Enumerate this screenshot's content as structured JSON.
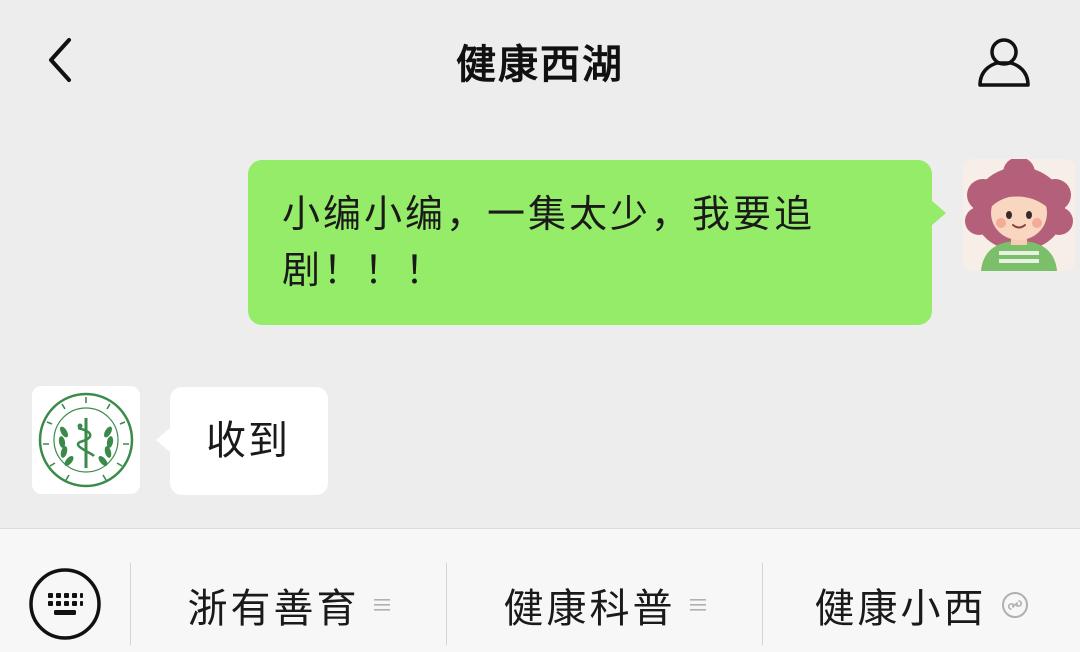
{
  "header": {
    "title": "健康西湖",
    "back_icon": "chevron-left-icon",
    "profile_icon": "person-icon"
  },
  "messages": [
    {
      "direction": "outgoing",
      "line1": "小编小编，一集太少，我要追",
      "line2": "剧！！！",
      "bubble_color": "#95ec69",
      "avatar": "user-avatar"
    },
    {
      "direction": "incoming",
      "text": "收到",
      "bubble_color": "#ffffff",
      "avatar": "org-logo-avatar"
    }
  ],
  "bottom_menu": {
    "keyboard_icon": "keyboard-icon",
    "items": [
      {
        "label": "浙有善育",
        "icon": "menu-lines-icon"
      },
      {
        "label": "健康科普",
        "icon": "menu-lines-icon"
      },
      {
        "label": "健康小西",
        "icon": "mini-program-icon"
      }
    ]
  },
  "colors": {
    "background": "#ededed",
    "outgoing_bubble": "#95ec69",
    "incoming_bubble": "#ffffff",
    "bottom_bar": "#f7f7f7",
    "logo_green": "#3a8a4a"
  }
}
